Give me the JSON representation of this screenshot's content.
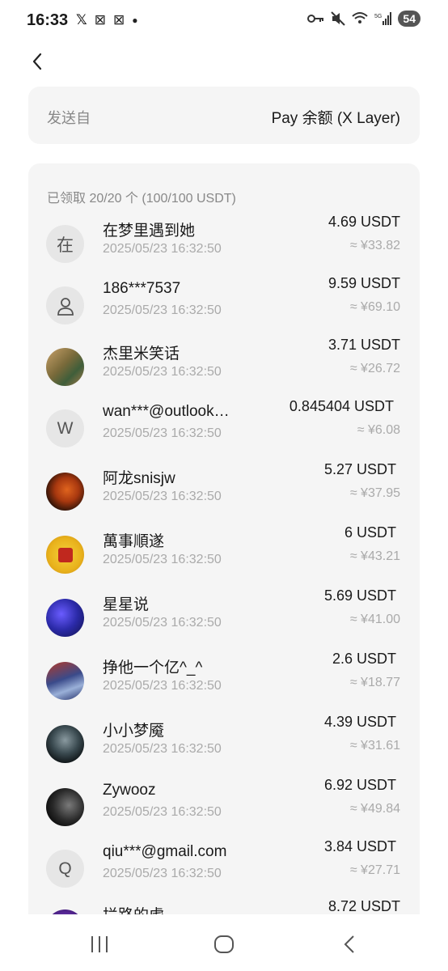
{
  "status_bar": {
    "time": "16:33",
    "left_icons": [
      "x-icon",
      "app-icon",
      "app-icon",
      "dot-icon"
    ],
    "battery": "54"
  },
  "sender": {
    "label": "发送自",
    "value": "Pay 余额 (X Layer)"
  },
  "summary": "已领取 20/20 个 (100/100 USDT)",
  "rows": [
    {
      "avatar_letter": "在",
      "name": "在梦里遇到她",
      "time": "2025/05/23 16:32:50",
      "amount": "4.69 USDT",
      "fiat": "≈ ¥33.82"
    },
    {
      "avatar_icon": "person-icon",
      "name": "186***7537",
      "time": "2025/05/23 16:32:50",
      "amount": "9.59 USDT",
      "fiat": "≈ ¥69.10"
    },
    {
      "avatar_image": "photo",
      "name": "杰里米笑话",
      "time": "2025/05/23 16:32:50",
      "amount": "3.71 USDT",
      "fiat": "≈ ¥26.72"
    },
    {
      "avatar_letter": "W",
      "name": "wan***@outlook…",
      "time": "2025/05/23 16:32:50",
      "amount": "0.845404 USDT",
      "fiat": "≈ ¥6.08"
    },
    {
      "avatar_image": "photo",
      "name": "阿龙snisjw",
      "time": "2025/05/23 16:32:50",
      "amount": "5.27 USDT",
      "fiat": "≈ ¥37.95"
    },
    {
      "avatar_image": "photo",
      "name": "萬事順遂",
      "time": "2025/05/23 16:32:50",
      "amount": "6 USDT",
      "fiat": "≈ ¥43.21"
    },
    {
      "avatar_image": "photo",
      "name": "星星说",
      "time": "2025/05/23 16:32:50",
      "amount": "5.69 USDT",
      "fiat": "≈ ¥41.00"
    },
    {
      "avatar_image": "photo",
      "name": "挣他一个亿^_^",
      "time": "2025/05/23 16:32:50",
      "amount": "2.6 USDT",
      "fiat": "≈ ¥18.77"
    },
    {
      "avatar_image": "photo",
      "name": "小小梦魇",
      "time": "2025/05/23 16:32:50",
      "amount": "4.39 USDT",
      "fiat": "≈ ¥31.61"
    },
    {
      "avatar_image": "photo",
      "name": "Zywooz",
      "time": "2025/05/23 16:32:50",
      "amount": "6.92 USDT",
      "fiat": "≈ ¥49.84"
    },
    {
      "avatar_letter": "Q",
      "name": "qiu***@gmail.com",
      "time": "2025/05/23 16:32:50",
      "amount": "3.84 USDT",
      "fiat": "≈ ¥27.71"
    },
    {
      "avatar_image": "photo",
      "name": "拦路的虎",
      "time": "",
      "amount": "8.72 USDT",
      "fiat": ""
    }
  ],
  "colors": {
    "card_bg": "#f5f5f5",
    "secondary_text": "#aaaaaa",
    "primary_text": "#1a1a1a"
  }
}
